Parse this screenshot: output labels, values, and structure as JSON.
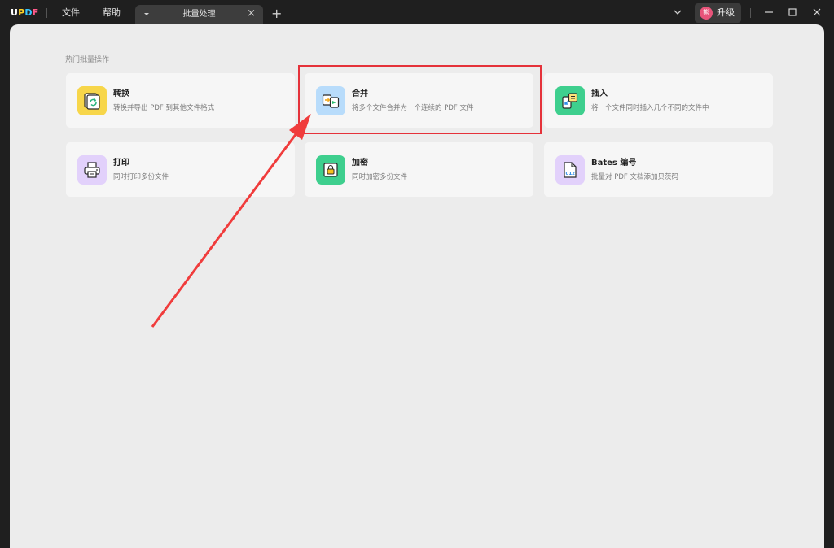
{
  "app": {
    "logo": {
      "u": "U",
      "p": "P",
      "d": "D",
      "f": "F"
    },
    "menu": {
      "file": "文件",
      "help": "帮助"
    },
    "tab": {
      "title": "批量处理",
      "close": "×"
    },
    "new_tab": "+",
    "upgrade": {
      "avatar": "熊",
      "label": "升级"
    }
  },
  "main": {
    "section_title": "热门批量操作",
    "cards": [
      {
        "title": "转换",
        "desc": "转换并导出 PDF 到其他文件格式",
        "icon": "convert-icon",
        "color": "#f7d64a"
      },
      {
        "title": "合并",
        "desc": "将多个文件合并为一个连续的 PDF 文件",
        "icon": "merge-icon",
        "color": "#b8dcfb"
      },
      {
        "title": "插入",
        "desc": "将一个文件同时插入几个不同的文件中",
        "icon": "insert-icon",
        "color": "#3ecf8e"
      },
      {
        "title": "打印",
        "desc": "同时打印多份文件",
        "icon": "print-icon",
        "color": "#e2d1fb"
      },
      {
        "title": "加密",
        "desc": "同时加密多份文件",
        "icon": "encrypt-icon",
        "color": "#3ecf8e"
      },
      {
        "title": "Bates 编号",
        "desc": "批量对 PDF 文档添加贝茨码",
        "icon": "bates-icon",
        "color": "#e2d1fb"
      }
    ]
  },
  "annotation": {
    "highlight_color": "#e5323a",
    "arrow_color": "#f03c3c"
  }
}
